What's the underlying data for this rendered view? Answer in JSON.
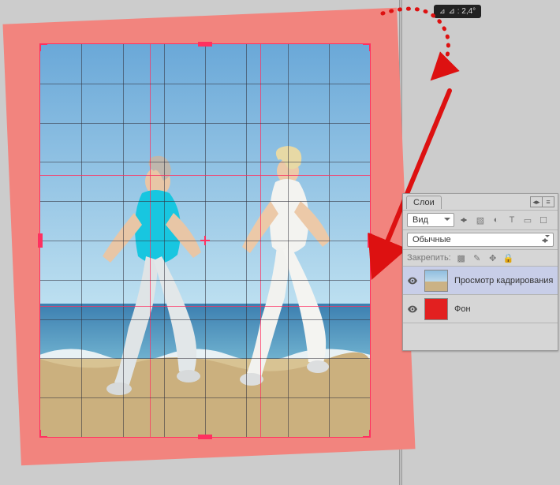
{
  "rotation": {
    "label": "⊿ : 2,4°",
    "value_deg": 2.4
  },
  "crop": {
    "grid": {
      "rows": 10,
      "cols": 8,
      "thirds": true
    }
  },
  "panel": {
    "title": "Слои",
    "kind_label": "Вид",
    "blend_mode": "Обычные",
    "lock_label": "Закрепить:",
    "layers": [
      {
        "name": "Просмотр кадрирования",
        "visible": true,
        "selected": true,
        "thumb": "photo"
      },
      {
        "name": "Фон",
        "visible": true,
        "selected": false,
        "thumb": "red"
      }
    ]
  }
}
